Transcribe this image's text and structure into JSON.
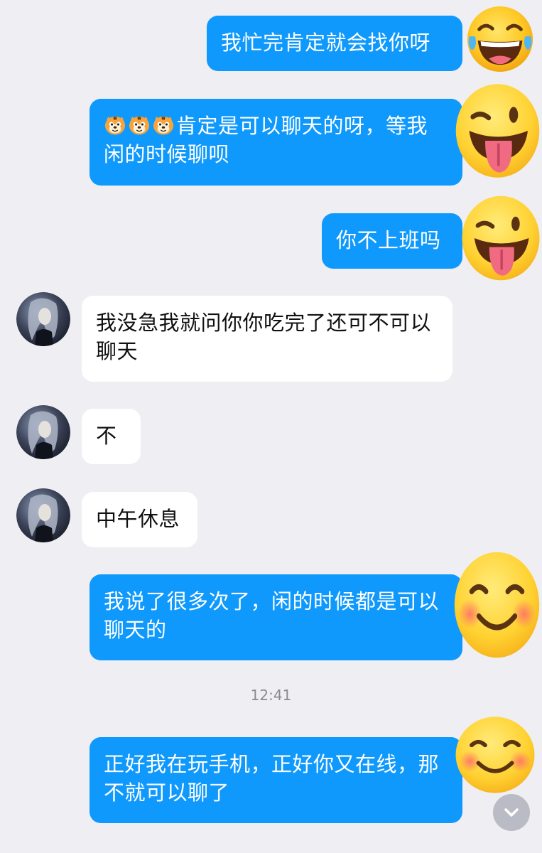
{
  "messages": [
    {
      "id": "m1",
      "text": "我忙完肯定就会找你呀",
      "side": "outgoing",
      "reaction": "tears-of-joy-emoji-icon"
    },
    {
      "id": "m2",
      "prefix_icons": [
        "tiger-face-icon",
        "tiger-face-icon",
        "tiger-face-icon"
      ],
      "text": "肯定是可以聊天的呀，等我闲的时候聊呗",
      "side": "outgoing",
      "reaction": "winking-tongue-emoji-icon"
    },
    {
      "id": "m3",
      "text": "你不上班吗",
      "side": "outgoing",
      "reaction": "winking-tongue-emoji-icon"
    },
    {
      "id": "m4",
      "text": "我没急我就问你你吃完了还可不可以聊天",
      "side": "incoming"
    },
    {
      "id": "m5",
      "text": "不",
      "side": "incoming"
    },
    {
      "id": "m6",
      "text": "中午休息",
      "side": "incoming"
    },
    {
      "id": "m7",
      "text": "我说了很多次了，闲的时候都是可以聊天的",
      "side": "outgoing",
      "reaction": "blushing-smile-emoji-icon"
    },
    {
      "id": "m8",
      "text": "正好我在玩手机，正好你又在线，那不就可以聊了",
      "side": "outgoing",
      "reaction": "blushing-smile-emoji-icon"
    }
  ],
  "timestamp": "12:41",
  "colors": {
    "background": "#eeeef3",
    "outgoing_bubble": "#0f99fd",
    "incoming_bubble": "#ffffff"
  },
  "icons": {
    "scroll_down": "chevron-down-icon",
    "contact_avatar": "avatar"
  }
}
